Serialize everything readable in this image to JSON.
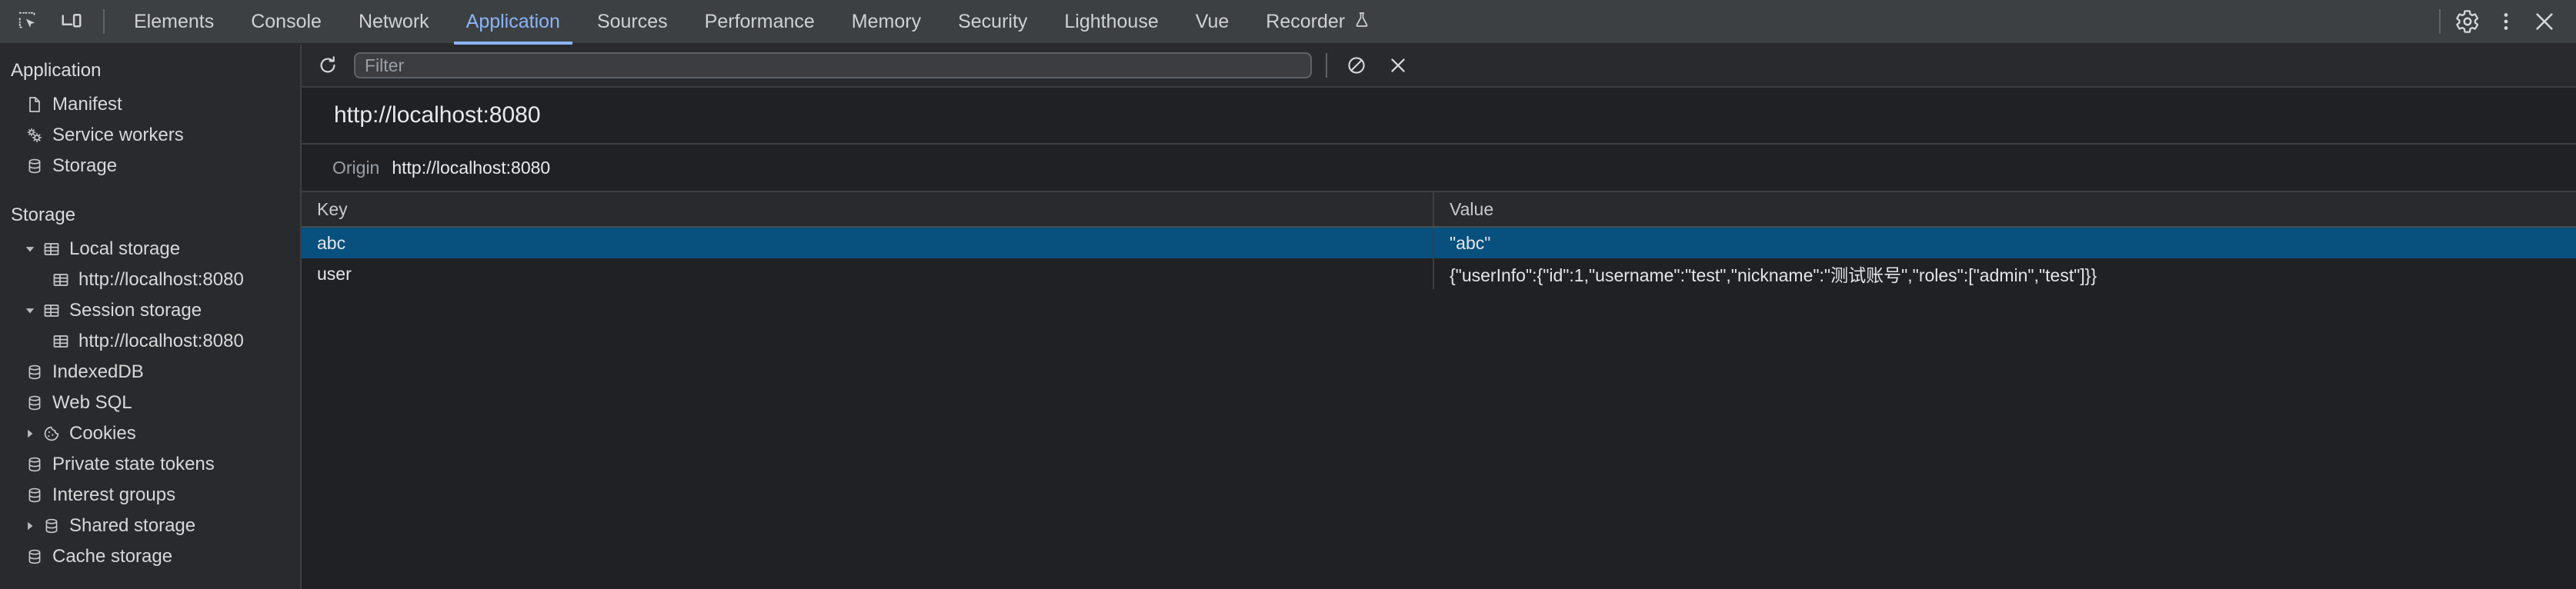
{
  "toolbar": {
    "inspect_icon": "inspect-element-icon",
    "device_icon": "device-toolbar-icon",
    "settings_icon": "gear-icon",
    "more_icon": "kebab-menu-icon",
    "close_icon": "close-icon",
    "tabs": [
      {
        "label": "Elements",
        "active": false,
        "experimental": false
      },
      {
        "label": "Console",
        "active": false,
        "experimental": false
      },
      {
        "label": "Network",
        "active": false,
        "experimental": false
      },
      {
        "label": "Application",
        "active": true,
        "experimental": false
      },
      {
        "label": "Sources",
        "active": false,
        "experimental": false
      },
      {
        "label": "Performance",
        "active": false,
        "experimental": false
      },
      {
        "label": "Memory",
        "active": false,
        "experimental": false
      },
      {
        "label": "Security",
        "active": false,
        "experimental": false
      },
      {
        "label": "Lighthouse",
        "active": false,
        "experimental": false
      },
      {
        "label": "Vue",
        "active": false,
        "experimental": false
      },
      {
        "label": "Recorder",
        "active": false,
        "experimental": true
      }
    ],
    "accent_color": "#8ab4f8"
  },
  "sidebar": {
    "application": {
      "title": "Application",
      "items": [
        {
          "label": "Manifest",
          "icon": "document-icon",
          "indent": 1,
          "twisty": ""
        },
        {
          "label": "Service workers",
          "icon": "gears-icon",
          "indent": 1,
          "twisty": ""
        },
        {
          "label": "Storage",
          "icon": "database-icon",
          "indent": 1,
          "twisty": ""
        }
      ]
    },
    "storage": {
      "title": "Storage",
      "items": [
        {
          "label": "Local storage",
          "icon": "table-icon",
          "indent": 1,
          "twisty": "expanded"
        },
        {
          "label": "http://localhost:8080",
          "icon": "table-icon",
          "indent": 2,
          "twisty": ""
        },
        {
          "label": "Session storage",
          "icon": "table-icon",
          "indent": 1,
          "twisty": "expanded"
        },
        {
          "label": "http://localhost:8080",
          "icon": "table-icon",
          "indent": 2,
          "twisty": ""
        },
        {
          "label": "IndexedDB",
          "icon": "database-icon",
          "indent": 1,
          "twisty": ""
        },
        {
          "label": "Web SQL",
          "icon": "database-icon",
          "indent": 1,
          "twisty": ""
        },
        {
          "label": "Cookies",
          "icon": "cookie-icon",
          "indent": 1,
          "twisty": "collapsed"
        },
        {
          "label": "Private state tokens",
          "icon": "database-icon",
          "indent": 1,
          "twisty": ""
        },
        {
          "label": "Interest groups",
          "icon": "database-icon",
          "indent": 1,
          "twisty": ""
        },
        {
          "label": "Shared storage",
          "icon": "database-icon",
          "indent": 1,
          "twisty": "collapsed"
        },
        {
          "label": "Cache storage",
          "icon": "database-icon",
          "indent": 1,
          "twisty": ""
        }
      ]
    }
  },
  "filterbar": {
    "refresh_icon": "refresh-icon",
    "filter_value": "",
    "filter_placeholder": "Filter",
    "clear_all_icon": "clear-all-icon",
    "delete_icon": "delete-selected-icon"
  },
  "panel": {
    "url_title": "http://localhost:8080",
    "origin_label": "Origin",
    "origin_value": "http://localhost:8080"
  },
  "table": {
    "columns": [
      "Key",
      "Value"
    ],
    "rows": [
      {
        "key": "abc",
        "value": "\"abc\"",
        "selected": true
      },
      {
        "key": "user",
        "value": "{\"userInfo\":{\"id\":1,\"username\":\"test\",\"nickname\":\"测试账号\",\"roles\":[\"admin\",\"test\"]}}",
        "selected": false
      }
    ],
    "selected_row_color": "#08507e"
  }
}
